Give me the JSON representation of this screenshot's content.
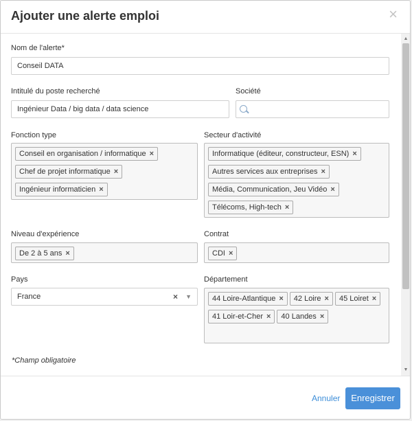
{
  "dialog": {
    "title": "Ajouter une alerte emploi",
    "close_symbol": "×"
  },
  "fields": {
    "alert_name": {
      "label": "Nom de l'alerte*",
      "value": "Conseil DATA"
    },
    "job_title": {
      "label": "Intitulé du poste recherché",
      "value": "Ingénieur Data / big data / data science"
    },
    "company": {
      "label": "Société",
      "value": "",
      "icon": "search-icon"
    },
    "function_type": {
      "label": "Fonction type",
      "tags": [
        "Conseil en organisation / informatique",
        "Chef de projet informatique",
        "Ingénieur informaticien"
      ]
    },
    "sector": {
      "label": "Secteur d'activité",
      "tags": [
        "Informatique (éditeur, constructeur, ESN)",
        "Autres services aux entreprises",
        "Média, Communication, Jeu Vidéo",
        "Télécoms, High-tech"
      ]
    },
    "experience": {
      "label": "Niveau d'expérience",
      "tags": [
        "De 2 à 5 ans"
      ]
    },
    "contract": {
      "label": "Contrat",
      "tags": [
        "CDI"
      ]
    },
    "country": {
      "label": "Pays",
      "value": "France",
      "clear_symbol": "×",
      "arrow_symbol": "▼"
    },
    "department": {
      "label": "Département",
      "tags": [
        "44 Loire-Atlantique",
        "42 Loire",
        "45 Loiret",
        "41 Loir-et-Cher",
        "40 Landes"
      ]
    }
  },
  "required_note": "*Champ obligatoire",
  "footer": {
    "cancel_label": "Annuler",
    "save_label": "Enregistrer"
  },
  "tag_remove_symbol": "×",
  "colors": {
    "accent": "#4a90d9",
    "link": "#3c8dd8"
  }
}
